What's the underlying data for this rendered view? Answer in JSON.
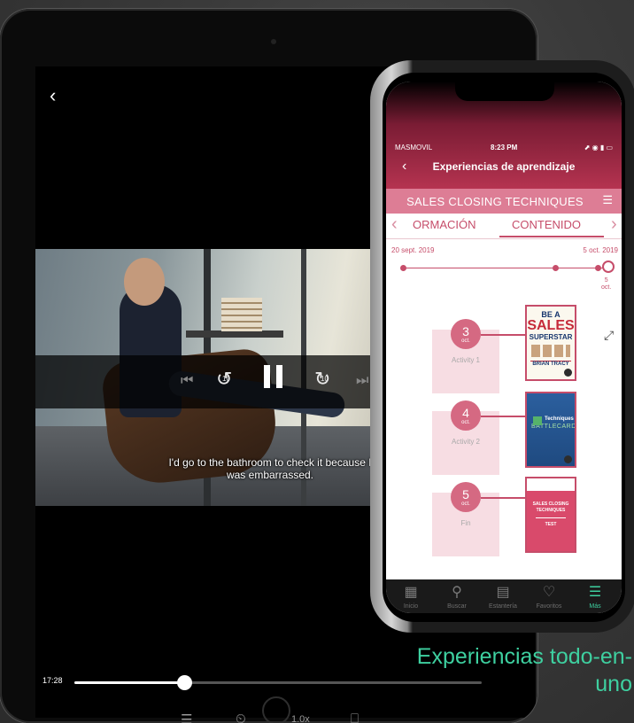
{
  "player": {
    "subtitle": "I'd go to the bathroom to check it because I was embarrassed.",
    "current_time": "17:28",
    "progress_fraction": 0.27,
    "speed_label": "1.0x",
    "icons": {
      "back": "chevron-left-icon",
      "skip_previous": "skip-previous-icon",
      "rewind": "rewind-10-icon",
      "pause": "pause-icon",
      "forward": "forward-10-icon",
      "skip_next": "skip-next-icon",
      "chapters": "list-icon",
      "sleep_timer": "timer-icon",
      "bookmark": "bookmark-icon"
    },
    "rewind_label": "10",
    "forward_label": "10"
  },
  "phone": {
    "status": {
      "carrier": "MASMOVIL",
      "time": "8:23 PM",
      "icons": "⬈ ◉ ▮ ▭"
    },
    "nav_title": "Experiencias de aprendizaje",
    "course_title": "SALES CLOSING TECHNIQUES",
    "tabs": [
      {
        "label": "ORMACIÓN",
        "active": false
      },
      {
        "label": "CONTENIDO",
        "active": true
      }
    ],
    "timeline": {
      "start_date": "20 sept. 2019",
      "end_date": "5 oct. 2019",
      "end_day": "5",
      "end_month": "oct."
    },
    "activities": [
      {
        "day": "3",
        "month": "oct.",
        "label": "Activity 1"
      },
      {
        "day": "4",
        "month": "oct.",
        "label": "Activity 2"
      },
      {
        "day": "5",
        "month": "oct.",
        "label": "Fin"
      }
    ],
    "books": [
      {
        "top": "BE A",
        "title": "SALES",
        "subtitle": "SUPERSTAR",
        "author": "BRIAN TRACY"
      },
      {
        "line1": "Techniques",
        "line2": "BATTLECARD"
      },
      {
        "line1": "SALES CLOSING",
        "line2": "TECHNIQUES",
        "line3": "TEST"
      }
    ],
    "tabbar": [
      {
        "label": "Inicio",
        "icon": "grid-icon",
        "glyph": "▦",
        "active": false
      },
      {
        "label": "Buscar",
        "icon": "search-icon",
        "glyph": "⚲",
        "active": false
      },
      {
        "label": "Estantería",
        "icon": "shelf-icon",
        "glyph": "▤",
        "active": false
      },
      {
        "label": "Favoritos",
        "icon": "heart-icon",
        "glyph": "♡",
        "active": false
      },
      {
        "label": "Más",
        "icon": "menu-icon",
        "glyph": "☰",
        "active": true
      }
    ]
  },
  "tagline": "Experiencias todo-en-uno",
  "colors": {
    "accent_green": "#3ed0a0",
    "brand_pink": "#c64d6a",
    "header_pink": "#dd7d95"
  }
}
